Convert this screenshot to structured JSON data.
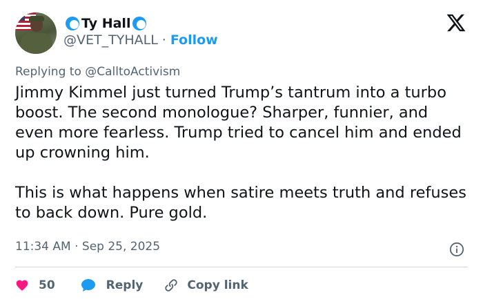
{
  "user": {
    "display_name": "Ty Hall",
    "handle": "@VET_TYHALL",
    "separator": "·",
    "follow_label": "Follow"
  },
  "reply": {
    "prefix": "Replying to",
    "mention": "@CalltoActivism"
  },
  "tweet": {
    "paragraph_1": "Jimmy Kimmel just turned Trump’s tantrum into a turbo boost. The second monologue? Sharper, funnier, and even more fearless. Trump tried to cancel him and ended up crowning him.",
    "paragraph_2": "This is what happens when satire meets truth and refuses to back down. Pure gold."
  },
  "timestamp": "11:34 AM · Sep 25, 2025",
  "actions": {
    "like_count": "50",
    "reply_label": "Reply",
    "copy_label": "Copy link"
  },
  "colors": {
    "accent": "#1d9bf0",
    "like": "#f91880",
    "muted": "#536471",
    "text": "#0f1419"
  },
  "icons": [
    "x-logo-icon",
    "wave-emoji-icon",
    "info-icon",
    "heart-icon",
    "reply-bubble-icon",
    "link-icon"
  ]
}
